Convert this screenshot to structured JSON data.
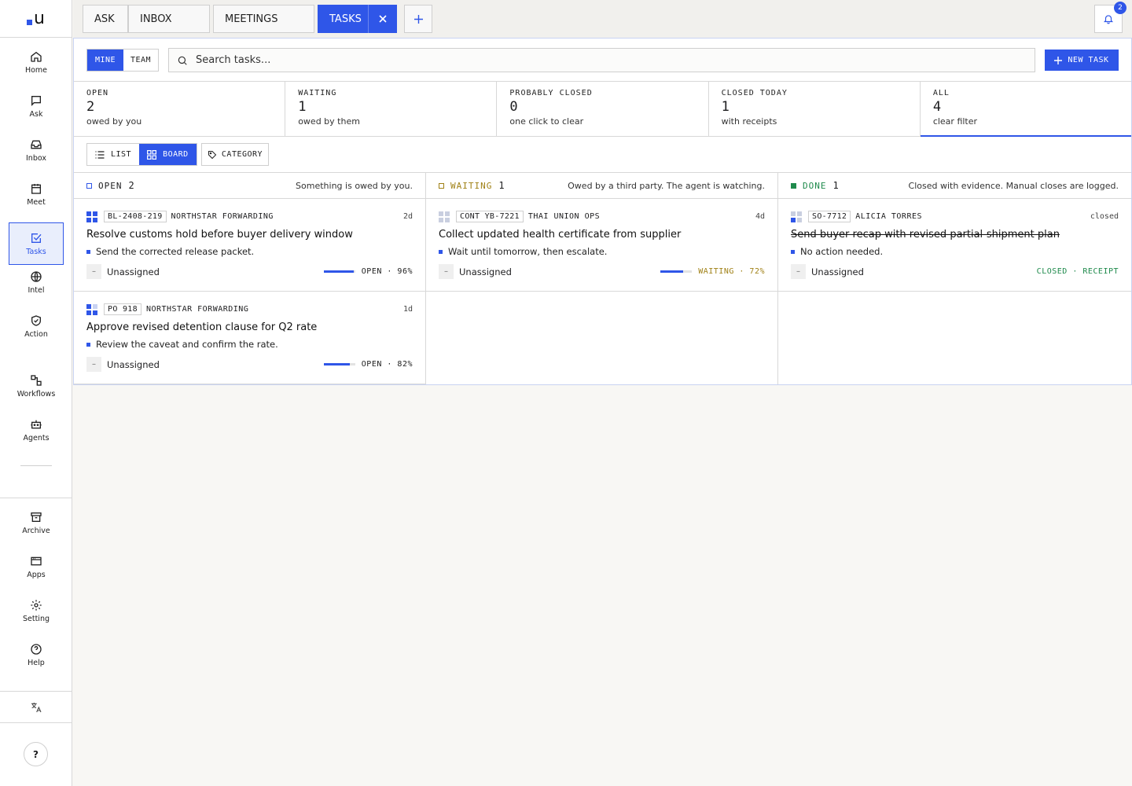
{
  "brand": {
    "logo_text": "u",
    "accent": "#2f56e8"
  },
  "sidebar": {
    "items": [
      {
        "label": "Home",
        "icon": "home-icon"
      },
      {
        "label": "Ask",
        "icon": "chat-icon"
      },
      {
        "label": "Inbox",
        "icon": "inbox-icon"
      },
      {
        "label": "Meet",
        "icon": "calendar-icon"
      },
      {
        "label": "Tasks",
        "icon": "task-check-icon",
        "active": true
      },
      {
        "label": "Intel",
        "icon": "globe-icon"
      },
      {
        "label": "Action",
        "icon": "shield-check-icon"
      },
      {
        "label": "Workflows",
        "icon": "workflow-icon"
      },
      {
        "label": "Agents",
        "icon": "robot-icon"
      }
    ],
    "bottom": [
      {
        "label": "Archive",
        "icon": "archive-icon"
      },
      {
        "label": "Apps",
        "icon": "app-window-icon"
      },
      {
        "label": "Setting",
        "icon": "gear-icon"
      },
      {
        "label": "Help",
        "icon": "help-circle-icon"
      }
    ],
    "help_button": "?"
  },
  "tabs": {
    "items": [
      "ASK",
      "INBOX",
      "MEETINGS",
      "TASKS"
    ],
    "active": "TASKS",
    "notification_count": "2"
  },
  "filters": {
    "scope": [
      "MINE",
      "TEAM"
    ],
    "scope_selected": "MINE",
    "search_placeholder": "Search tasks...",
    "new_task_label": "NEW TASK"
  },
  "stats": [
    {
      "caption": "OPEN",
      "count": "2",
      "sub": "owed by you"
    },
    {
      "caption": "WAITING",
      "count": "1",
      "sub": "owed by them"
    },
    {
      "caption": "PROBABLY CLOSED",
      "count": "0",
      "sub": "one click to clear"
    },
    {
      "caption": "CLOSED TODAY",
      "count": "1",
      "sub": "with receipts"
    },
    {
      "caption": "ALL",
      "count": "4",
      "sub": "clear filter",
      "selected": true
    }
  ],
  "view": {
    "list_label": "LIST",
    "board_label": "BOARD",
    "selected": "BOARD",
    "category_label": "CATEGORY"
  },
  "columns": [
    {
      "name": "OPEN",
      "count": "2",
      "desc": "Something is owed by you.",
      "color": "#2f56e8",
      "cards": [
        {
          "code": "BL-2408-219",
          "party": "NORTHSTAR FORWARDING",
          "age": "2d",
          "title": "Resolve customs hold before buyer delivery window",
          "step": "Send the corrected release packet.",
          "assignee": "Unassigned",
          "status": "OPEN · 96%",
          "progress": 0.96
        },
        {
          "code": "PO 918",
          "party": "NORTHSTAR FORWARDING",
          "age": "1d",
          "title": "Approve revised detention clause for Q2 rate",
          "step": "Review the caveat and confirm the rate.",
          "assignee": "Unassigned",
          "status": "OPEN · 82%",
          "progress": 0.82
        }
      ]
    },
    {
      "name": "WAITING",
      "count": "1",
      "desc": "Owed by a third party. The agent is watching.",
      "color": "#a08116",
      "cards": [
        {
          "code": "CONT YB-7221",
          "party": "THAI UNION OPS",
          "age": "4d",
          "title": "Collect updated health certificate from supplier",
          "step": "Wait until tomorrow, then escalate.",
          "assignee": "Unassigned",
          "status": "WAITING · 72%",
          "progress": 0.72
        }
      ]
    },
    {
      "name": "DONE",
      "count": "1",
      "desc": "Closed with evidence. Manual closes are logged.",
      "color": "#1f8a4c",
      "cards": [
        {
          "code": "SO-7712",
          "party": "ALICIA TORRES",
          "age": "closed",
          "title": "Send buyer recap with revised partial-shipment plan",
          "step": "No action needed.",
          "assignee": "Unassigned",
          "status": "CLOSED · RECEIPT",
          "done": true
        }
      ]
    }
  ]
}
